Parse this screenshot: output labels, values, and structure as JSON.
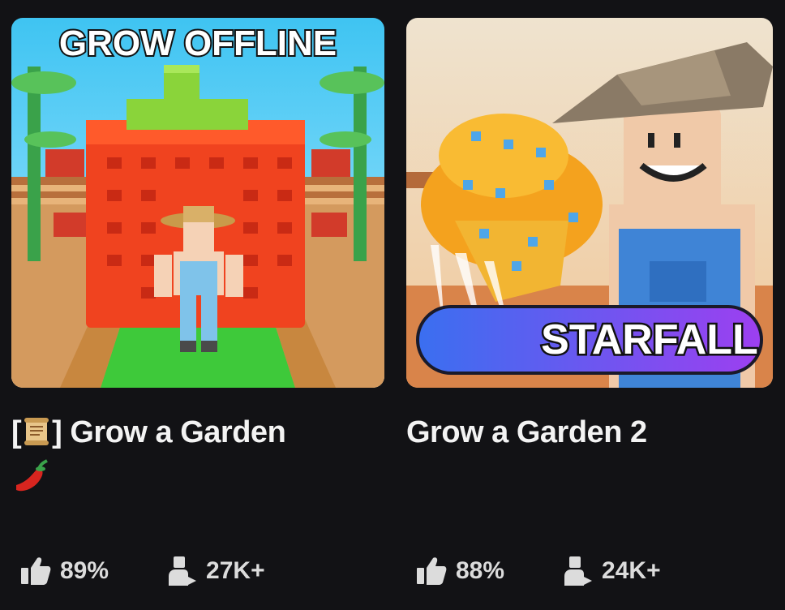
{
  "games": [
    {
      "thumbnail_banner": "GROW OFFLINE",
      "title_text": "Grow a Garden",
      "title_icon": "scroll-icon",
      "title_emoji": "pepper-icon",
      "rating": "89%",
      "players": "27K+"
    },
    {
      "thumbnail_banner": "STARFALL",
      "title_text": "Grow a Garden 2",
      "rating": "88%",
      "players": "24K+"
    }
  ],
  "icons": {
    "rating": "thumbs-up-icon",
    "players": "player-count-icon"
  },
  "colors": {
    "background": "#121215",
    "text": "#f3f3f3",
    "stat_text": "#dcdcdc"
  }
}
